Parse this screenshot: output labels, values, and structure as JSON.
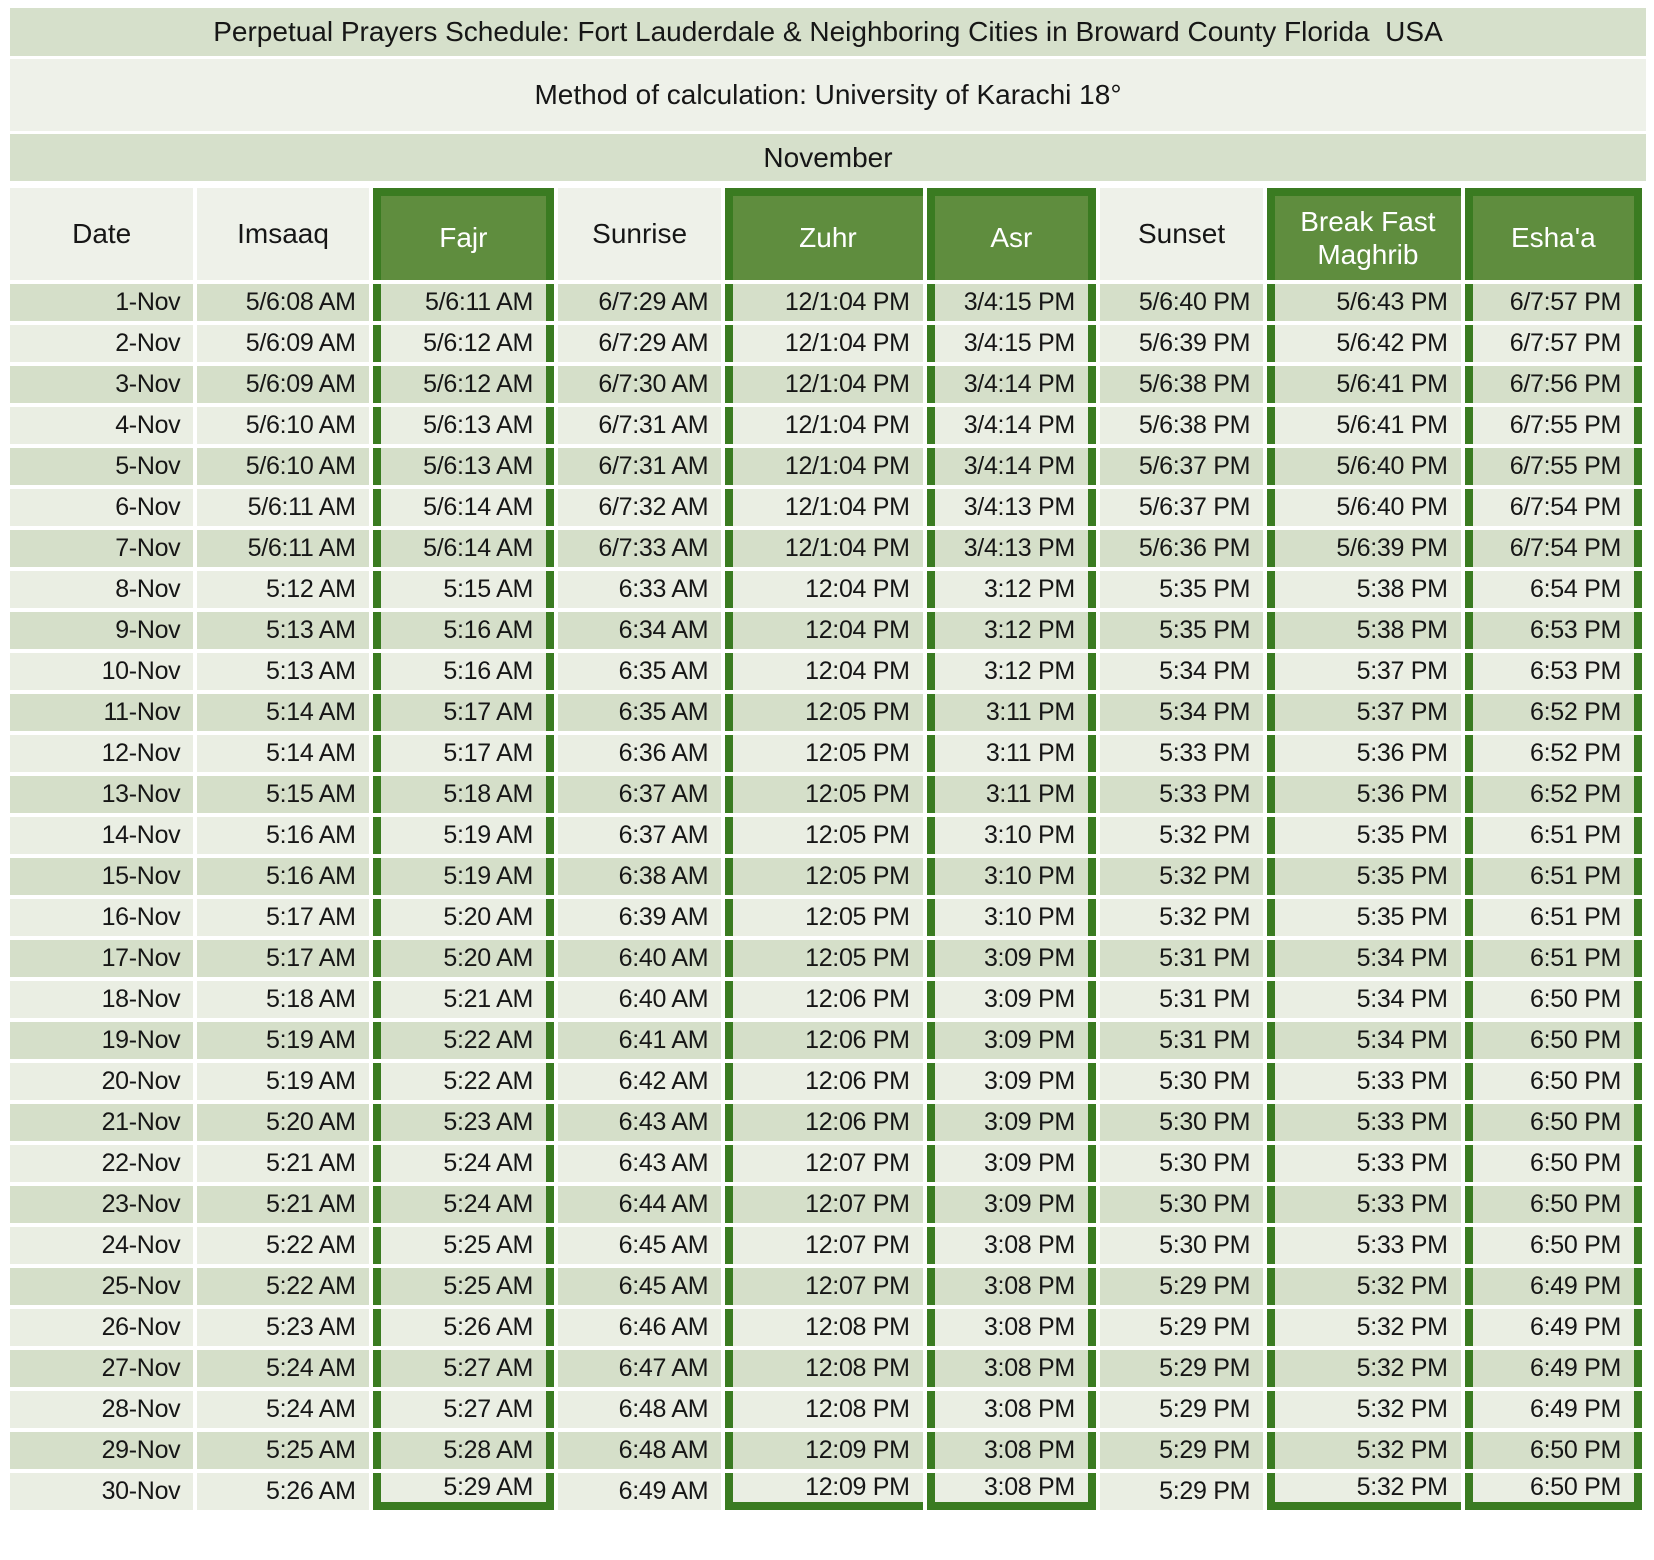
{
  "header": {
    "title": "Perpetual Prayers Schedule: Fort Lauderdale & Neighboring Cities in Broward County Florida  USA",
    "method": "Method of calculation: University of Karachi 18°",
    "month": "November"
  },
  "table": {
    "columns": [
      {
        "key": "date",
        "label": "Date",
        "highlight": false
      },
      {
        "key": "imsaaq",
        "label": "Imsaaq",
        "highlight": false
      },
      {
        "key": "fajr",
        "label": "Fajr",
        "highlight": true
      },
      {
        "key": "sunrise",
        "label": "Sunrise",
        "highlight": false
      },
      {
        "key": "zuhr",
        "label": "Zuhr",
        "highlight": true
      },
      {
        "key": "asr",
        "label": "Asr",
        "highlight": true
      },
      {
        "key": "sunset",
        "label": "Sunset",
        "highlight": false
      },
      {
        "key": "maghrib",
        "label": "Break Fast Maghrib",
        "highlight": true
      },
      {
        "key": "eshaa",
        "label": "Esha'a",
        "highlight": true
      }
    ],
    "rows": [
      [
        "1-Nov",
        "5/6:08 AM",
        "5/6:11 AM",
        "6/7:29 AM",
        "12/1:04 PM",
        "3/4:15 PM",
        "5/6:40 PM",
        "5/6:43 PM",
        "6/7:57 PM"
      ],
      [
        "2-Nov",
        "5/6:09 AM",
        "5/6:12 AM",
        "6/7:29 AM",
        "12/1:04 PM",
        "3/4:15 PM",
        "5/6:39 PM",
        "5/6:42 PM",
        "6/7:57 PM"
      ],
      [
        "3-Nov",
        "5/6:09 AM",
        "5/6:12 AM",
        "6/7:30 AM",
        "12/1:04 PM",
        "3/4:14 PM",
        "5/6:38 PM",
        "5/6:41 PM",
        "6/7:56 PM"
      ],
      [
        "4-Nov",
        "5/6:10 AM",
        "5/6:13 AM",
        "6/7:31 AM",
        "12/1:04 PM",
        "3/4:14 PM",
        "5/6:38 PM",
        "5/6:41 PM",
        "6/7:55 PM"
      ],
      [
        "5-Nov",
        "5/6:10 AM",
        "5/6:13 AM",
        "6/7:31 AM",
        "12/1:04 PM",
        "3/4:14 PM",
        "5/6:37 PM",
        "5/6:40 PM",
        "6/7:55 PM"
      ],
      [
        "6-Nov",
        "5/6:11 AM",
        "5/6:14 AM",
        "6/7:32 AM",
        "12/1:04 PM",
        "3/4:13 PM",
        "5/6:37 PM",
        "5/6:40 PM",
        "6/7:54 PM"
      ],
      [
        "7-Nov",
        "5/6:11 AM",
        "5/6:14 AM",
        "6/7:33 AM",
        "12/1:04 PM",
        "3/4:13 PM",
        "5/6:36 PM",
        "5/6:39 PM",
        "6/7:54 PM"
      ],
      [
        "8-Nov",
        "5:12 AM",
        "5:15 AM",
        "6:33 AM",
        "12:04 PM",
        "3:12 PM",
        "5:35 PM",
        "5:38 PM",
        "6:54 PM"
      ],
      [
        "9-Nov",
        "5:13 AM",
        "5:16 AM",
        "6:34 AM",
        "12:04 PM",
        "3:12 PM",
        "5:35 PM",
        "5:38 PM",
        "6:53 PM"
      ],
      [
        "10-Nov",
        "5:13 AM",
        "5:16 AM",
        "6:35 AM",
        "12:04 PM",
        "3:12 PM",
        "5:34 PM",
        "5:37 PM",
        "6:53 PM"
      ],
      [
        "11-Nov",
        "5:14 AM",
        "5:17 AM",
        "6:35 AM",
        "12:05 PM",
        "3:11 PM",
        "5:34 PM",
        "5:37 PM",
        "6:52 PM"
      ],
      [
        "12-Nov",
        "5:14 AM",
        "5:17 AM",
        "6:36 AM",
        "12:05 PM",
        "3:11 PM",
        "5:33 PM",
        "5:36 PM",
        "6:52 PM"
      ],
      [
        "13-Nov",
        "5:15 AM",
        "5:18 AM",
        "6:37 AM",
        "12:05 PM",
        "3:11 PM",
        "5:33 PM",
        "5:36 PM",
        "6:52 PM"
      ],
      [
        "14-Nov",
        "5:16 AM",
        "5:19 AM",
        "6:37 AM",
        "12:05 PM",
        "3:10 PM",
        "5:32 PM",
        "5:35 PM",
        "6:51 PM"
      ],
      [
        "15-Nov",
        "5:16 AM",
        "5:19 AM",
        "6:38 AM",
        "12:05 PM",
        "3:10 PM",
        "5:32 PM",
        "5:35 PM",
        "6:51 PM"
      ],
      [
        "16-Nov",
        "5:17 AM",
        "5:20 AM",
        "6:39 AM",
        "12:05 PM",
        "3:10 PM",
        "5:32 PM",
        "5:35 PM",
        "6:51 PM"
      ],
      [
        "17-Nov",
        "5:17 AM",
        "5:20 AM",
        "6:40 AM",
        "12:05 PM",
        "3:09 PM",
        "5:31 PM",
        "5:34 PM",
        "6:51 PM"
      ],
      [
        "18-Nov",
        "5:18 AM",
        "5:21 AM",
        "6:40 AM",
        "12:06 PM",
        "3:09 PM",
        "5:31 PM",
        "5:34 PM",
        "6:50 PM"
      ],
      [
        "19-Nov",
        "5:19 AM",
        "5:22 AM",
        "6:41 AM",
        "12:06 PM",
        "3:09 PM",
        "5:31 PM",
        "5:34 PM",
        "6:50 PM"
      ],
      [
        "20-Nov",
        "5:19 AM",
        "5:22 AM",
        "6:42 AM",
        "12:06 PM",
        "3:09 PM",
        "5:30 PM",
        "5:33 PM",
        "6:50 PM"
      ],
      [
        "21-Nov",
        "5:20 AM",
        "5:23 AM",
        "6:43 AM",
        "12:06 PM",
        "3:09 PM",
        "5:30 PM",
        "5:33 PM",
        "6:50 PM"
      ],
      [
        "22-Nov",
        "5:21 AM",
        "5:24 AM",
        "6:43 AM",
        "12:07 PM",
        "3:09 PM",
        "5:30 PM",
        "5:33 PM",
        "6:50 PM"
      ],
      [
        "23-Nov",
        "5:21 AM",
        "5:24 AM",
        "6:44 AM",
        "12:07 PM",
        "3:09 PM",
        "5:30 PM",
        "5:33 PM",
        "6:50 PM"
      ],
      [
        "24-Nov",
        "5:22 AM",
        "5:25 AM",
        "6:45 AM",
        "12:07 PM",
        "3:08 PM",
        "5:30 PM",
        "5:33 PM",
        "6:50 PM"
      ],
      [
        "25-Nov",
        "5:22 AM",
        "5:25 AM",
        "6:45 AM",
        "12:07 PM",
        "3:08 PM",
        "5:29 PM",
        "5:32 PM",
        "6:49 PM"
      ],
      [
        "26-Nov",
        "5:23 AM",
        "5:26 AM",
        "6:46 AM",
        "12:08 PM",
        "3:08 PM",
        "5:29 PM",
        "5:32 PM",
        "6:49 PM"
      ],
      [
        "27-Nov",
        "5:24 AM",
        "5:27 AM",
        "6:47 AM",
        "12:08 PM",
        "3:08 PM",
        "5:29 PM",
        "5:32 PM",
        "6:49 PM"
      ],
      [
        "28-Nov",
        "5:24 AM",
        "5:27 AM",
        "6:48 AM",
        "12:08 PM",
        "3:08 PM",
        "5:29 PM",
        "5:32 PM",
        "6:49 PM"
      ],
      [
        "29-Nov",
        "5:25 AM",
        "5:28 AM",
        "6:48 AM",
        "12:09 PM",
        "3:08 PM",
        "5:29 PM",
        "5:32 PM",
        "6:50 PM"
      ],
      [
        "30-Nov",
        "5:26 AM",
        "5:29 AM",
        "6:49 AM",
        "12:09 PM",
        "3:08 PM",
        "5:29 PM",
        "5:32 PM",
        "6:50 PM"
      ]
    ]
  },
  "colors": {
    "border_green": "#3a7b21",
    "header_green": "#5f8d3e",
    "row_dark": "#d5dfc9",
    "row_light": "#eaeee3",
    "band_green": "#d6e0cb",
    "band_light": "#eef1e9"
  }
}
